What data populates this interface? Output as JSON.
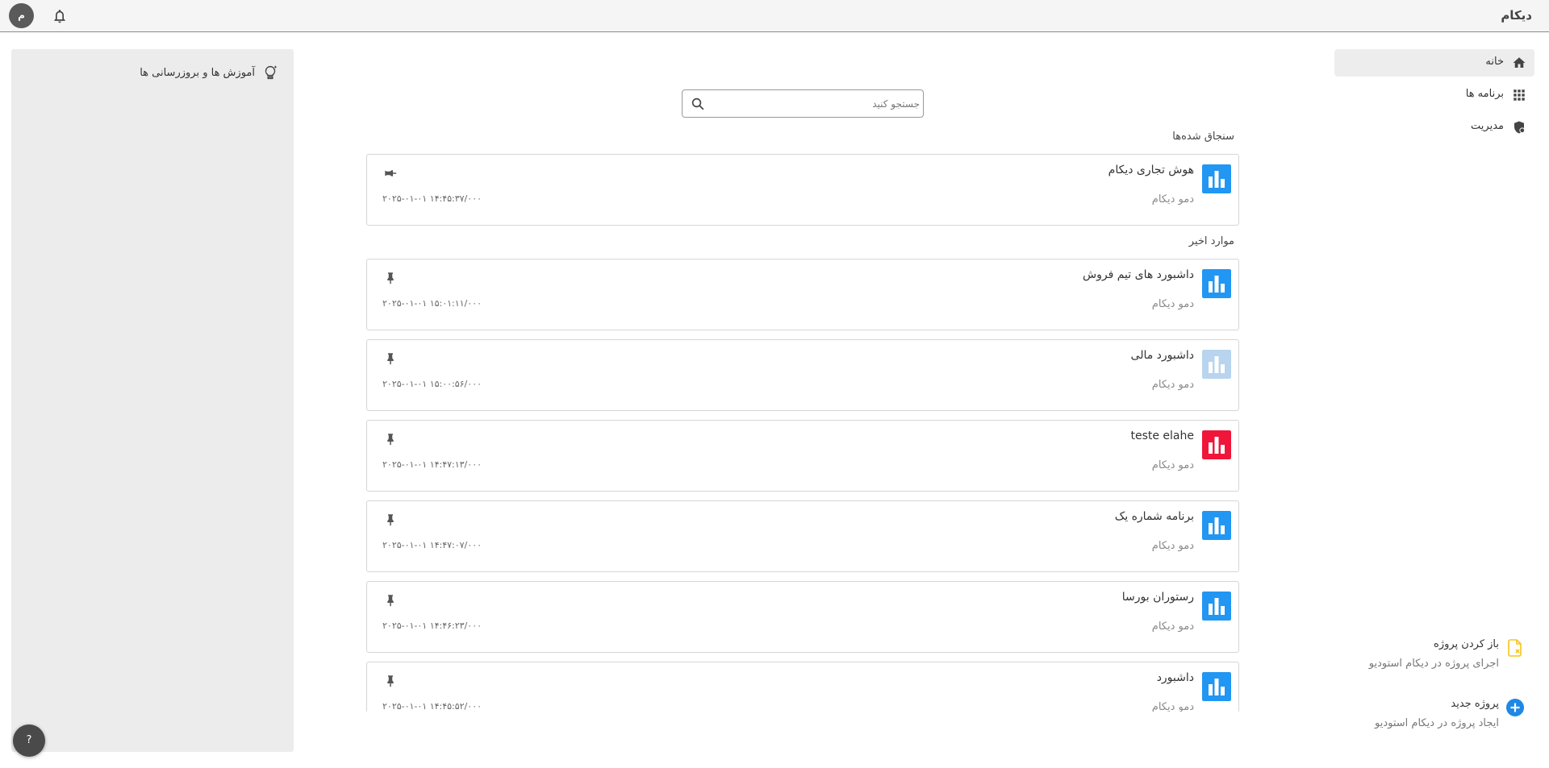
{
  "topbar": {
    "brand": "دیکام",
    "avatar_initial": "م"
  },
  "nav": [
    {
      "label": "خانه",
      "icon": "home-icon",
      "active": true
    },
    {
      "label": "برنامه ها",
      "icon": "apps-grid-icon",
      "active": false
    },
    {
      "label": "مدیریت",
      "icon": "admin-shield-icon",
      "active": false
    }
  ],
  "tips": {
    "label": "آموزش ها و بروزرسانی ها",
    "icon": "lightbulb-icon"
  },
  "help": {
    "label": "?"
  },
  "search": {
    "placeholder": "جستجو کنید",
    "value": ""
  },
  "pinned_section": {
    "title": "سنجاق شده‌ها"
  },
  "recent_section": {
    "title": "موارد اخیر"
  },
  "pinned": [
    {
      "name": "هوش تجاری دیکام",
      "owner": "دمو دیکام",
      "date": "۲۰۲۵-۰۱-۰۱ ۱۴:۴۵:۳۷/۰۰۰",
      "color": "#2196f3"
    }
  ],
  "recent": [
    {
      "name": "داشبورد های تیم فروش",
      "owner": "دمو دیکام",
      "date": "۲۰۲۵-۰۱-۰۱ ۱۵:۰۱:۱۱/۰۰۰",
      "color": "#2196f3"
    },
    {
      "name": "داشبورد مالی",
      "owner": "دمو دیکام",
      "date": "۲۰۲۵-۰۱-۰۱ ۱۵:۰۰:۵۶/۰۰۰",
      "color": "#b8d4ee"
    },
    {
      "name": "teste elahe",
      "owner": "دمو دیکام",
      "date": "۲۰۲۵-۰۱-۰۱ ۱۴:۴۷:۱۳/۰۰۰",
      "color": "#f0163a"
    },
    {
      "name": "برنامه شماره یک",
      "owner": "دمو دیکام",
      "date": "۲۰۲۵-۰۱-۰۱ ۱۴:۴۷:۰۷/۰۰۰",
      "color": "#2196f3"
    },
    {
      "name": "رستوران بورسا",
      "owner": "دمو دیکام",
      "date": "۲۰۲۵-۰۱-۰۱ ۱۴:۴۶:۲۳/۰۰۰",
      "color": "#2196f3"
    },
    {
      "name": "داشبورد",
      "owner": "دمو دیکام",
      "date": "۲۰۲۵-۰۱-۰۱ ۱۴:۴۵:۵۲/۰۰۰",
      "color": "#2196f3"
    }
  ],
  "actions": {
    "open_project": {
      "title": "باز کردن پروژه",
      "subtitle": "اجرای پروژه در دیکام استودیو",
      "icon": "open-file-icon",
      "color": "#f5c518"
    },
    "new_project": {
      "title": "پروژه جدید",
      "subtitle": "ایجاد پروژه در دیکام استودیو",
      "icon": "add-circle-icon",
      "color": "#1e88e5"
    }
  }
}
